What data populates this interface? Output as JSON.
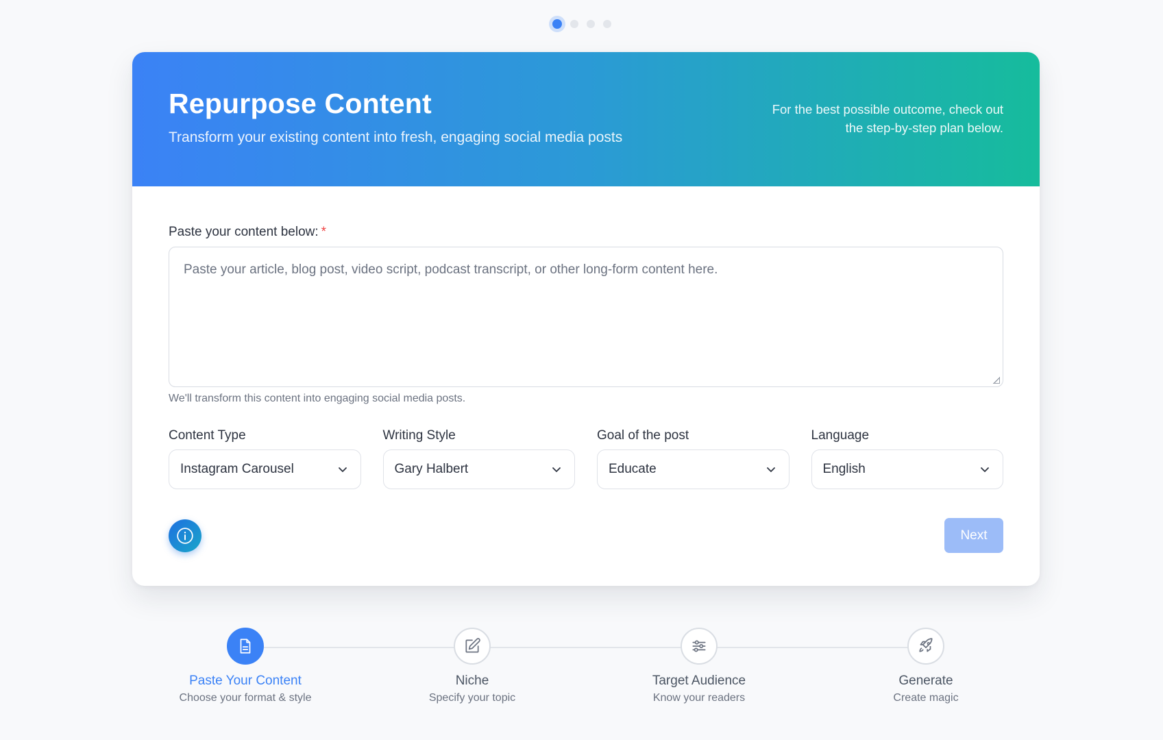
{
  "progress_dots": {
    "count": 4,
    "active_index": 0
  },
  "header": {
    "title": "Repurpose Content",
    "subtitle": "Transform your existing content into fresh, engaging social media posts",
    "hint_line1": "For the best possible outcome, check out",
    "hint_line2": "the step-by-step plan below."
  },
  "content_input": {
    "label": "Paste your content below:",
    "required_mark": "*",
    "placeholder": "Paste your article, blog post, video script, podcast transcript, or other long-form content here.",
    "value": "",
    "helper": "We'll transform this content into engaging social media posts."
  },
  "selects": [
    {
      "label": "Content Type",
      "value": "Instagram Carousel"
    },
    {
      "label": "Writing Style",
      "value": "Gary Halbert"
    },
    {
      "label": "Goal of the post",
      "value": "Educate"
    },
    {
      "label": "Language",
      "value": "English"
    }
  ],
  "actions": {
    "info_icon": "info-icon",
    "next_label": "Next",
    "next_enabled": false
  },
  "steps": [
    {
      "title": "Paste Your Content",
      "desc": "Choose your format & style",
      "icon": "document-icon",
      "active": true
    },
    {
      "title": "Niche",
      "desc": "Specify your topic",
      "icon": "pencil-icon",
      "active": false
    },
    {
      "title": "Target Audience",
      "desc": "Know your readers",
      "icon": "sliders-icon",
      "active": false
    },
    {
      "title": "Generate",
      "desc": "Create magic",
      "icon": "rocket-icon",
      "active": false
    }
  ],
  "colors": {
    "accent": "#3b82f6",
    "gradient_start": "#3b82f6",
    "gradient_end": "#16bc9c",
    "required": "#ef4444",
    "next_disabled": "#9cbcf8"
  }
}
